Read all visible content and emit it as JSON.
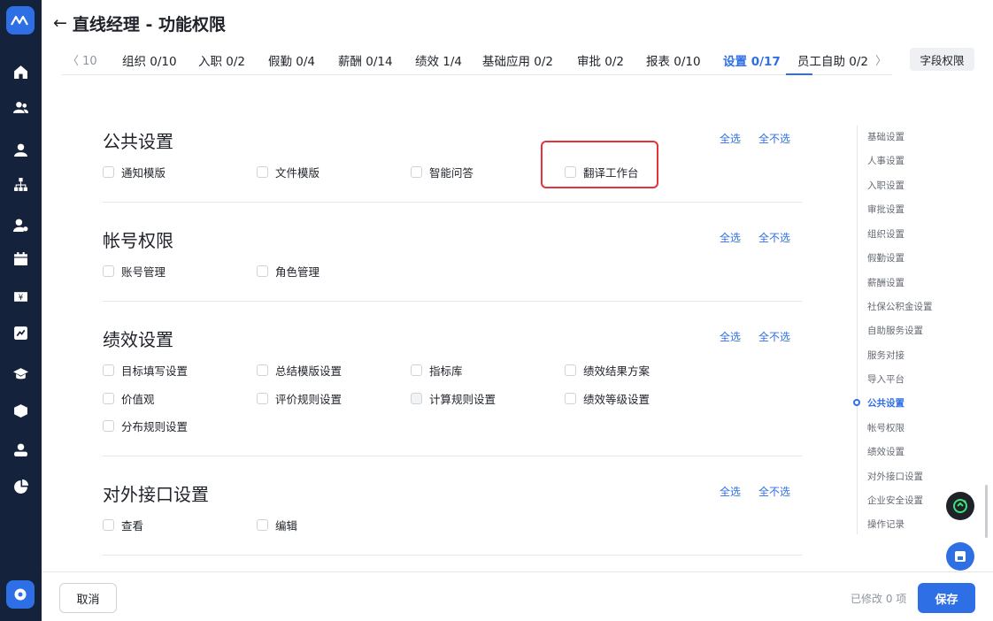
{
  "header": {
    "back_icon": "←",
    "title": "直线经理 - 功能权限"
  },
  "tabs": {
    "prev_label": "〈 10",
    "next_label": "〉",
    "items": [
      {
        "label": "组织 0/10"
      },
      {
        "label": "入职 0/2"
      },
      {
        "label": "假勤 0/4"
      },
      {
        "label": "薪酬 0/14"
      },
      {
        "label": "绩效 1/4"
      },
      {
        "label": "基础应用 0/2"
      },
      {
        "label": "审批 0/2"
      },
      {
        "label": "报表 0/10"
      },
      {
        "label": "设置 0/17",
        "active": true
      },
      {
        "label": "员工自助 0/2"
      }
    ],
    "field_permission_label": "字段权限"
  },
  "sections": [
    {
      "title": "公共设置",
      "select_all": "全选",
      "select_none": "全不选",
      "items": [
        "通知模版",
        "文件模版",
        "智能问答",
        "翻译工作台"
      ]
    },
    {
      "title": "帐号权限",
      "select_all": "全选",
      "select_none": "全不选",
      "items": [
        "账号管理",
        "角色管理"
      ]
    },
    {
      "title": "绩效设置",
      "select_all": "全选",
      "select_none": "全不选",
      "items": [
        "目标填写设置",
        "总结模版设置",
        "指标库",
        "绩效结果方案",
        "价值观",
        "评价规则设置",
        "计算规则设置",
        "绩效等级设置",
        "分布规则设置"
      ]
    },
    {
      "title": "对外接口设置",
      "select_all": "全选",
      "select_none": "全不选",
      "items": [
        "查看",
        "编辑"
      ]
    }
  ],
  "anchor_nav": {
    "items": [
      "基础设置",
      "人事设置",
      "入职设置",
      "审批设置",
      "组织设置",
      "假勤设置",
      "薪酬设置",
      "社保公积金设置",
      "自助服务设置",
      "服务对接",
      "导入平台",
      "公共设置",
      "帐号权限",
      "绩效设置",
      "对外接口设置",
      "企业安全设置",
      "操作记录"
    ],
    "active_index": 11
  },
  "sidebar": {
    "icons": [
      "home-icon",
      "team-icon",
      "person-icon",
      "org-chart-icon",
      "user-settings-icon",
      "calendar-icon",
      "salary-icon",
      "performance-icon",
      "education-icon",
      "cube-icon",
      "profile-icon",
      "pie-chart-icon",
      "settings-icon"
    ]
  },
  "footer": {
    "cancel_label": "取消",
    "modified_text": "已修改 0 项",
    "save_label": "保存"
  },
  "colors": {
    "primary": "#2f6fe6",
    "sidebar_bg": "#15223b",
    "highlight": "#e5333a"
  }
}
